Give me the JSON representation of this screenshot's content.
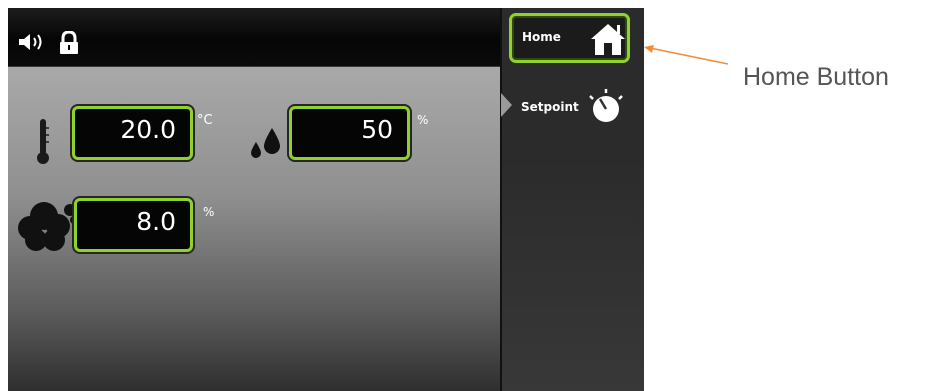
{
  "status_bar": {
    "icons": [
      "speaker-icon",
      "lock-icon"
    ]
  },
  "sidebar": {
    "home": {
      "label": "Home",
      "icon": "home-icon"
    },
    "setpoint": {
      "label": "Setpoint",
      "icon": "dial-icon"
    }
  },
  "readings": {
    "temperature": {
      "value": "20.0",
      "unit": "°C",
      "icon": "thermometer-icon"
    },
    "humidity": {
      "value": "50",
      "unit": "%",
      "icon": "water-drops-icon"
    },
    "co2": {
      "value": "8.0",
      "unit": "%",
      "icon": "cloud-icon"
    }
  },
  "annotation": {
    "text": "Home Button"
  },
  "colors": {
    "accent": "#8fd230",
    "arrow": "#f08c3c"
  }
}
